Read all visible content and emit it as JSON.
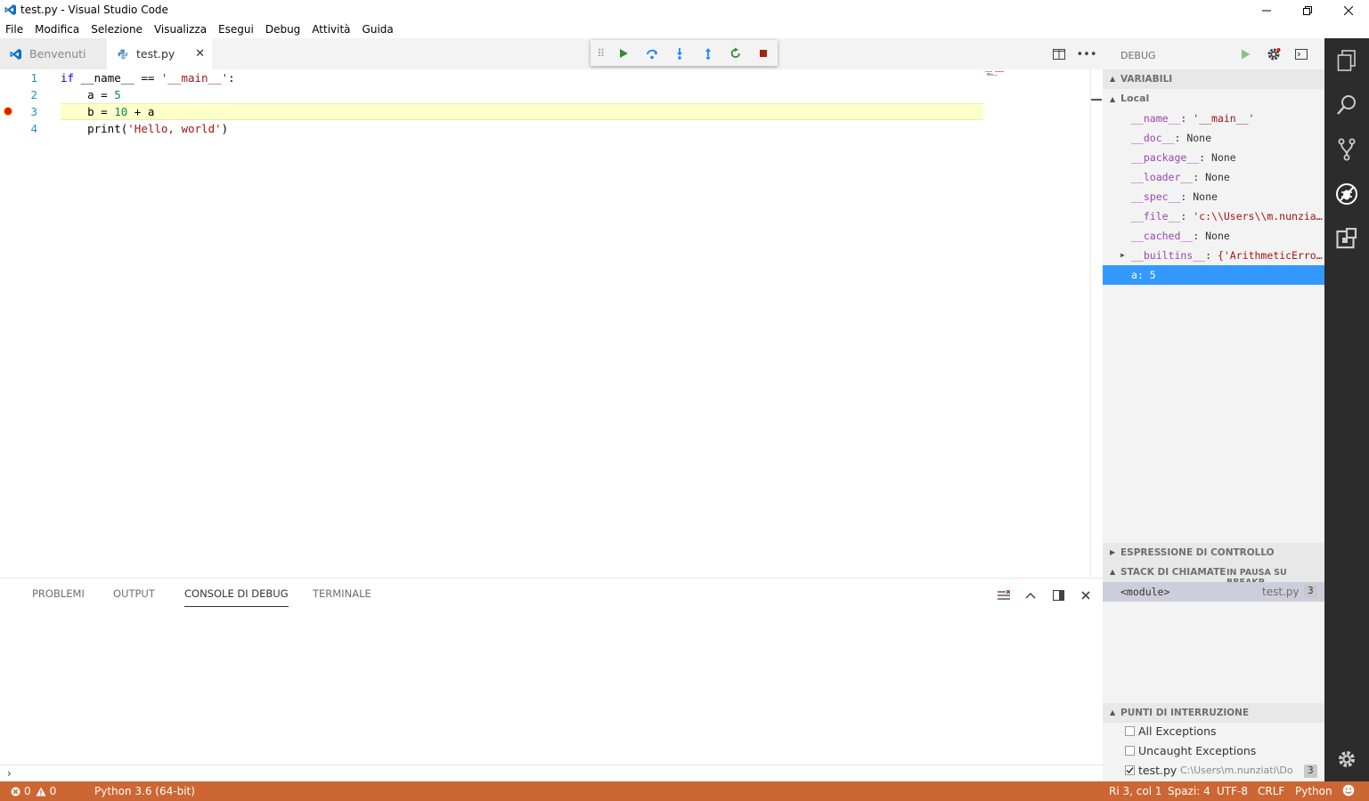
{
  "window": {
    "title": "test.py - Visual Studio Code"
  },
  "menu": [
    "File",
    "Modifica",
    "Selezione",
    "Visualizza",
    "Esegui",
    "Debug",
    "Attività",
    "Guida"
  ],
  "tabs": [
    {
      "label": "Benvenuti",
      "icon": "vscode-logo-icon",
      "active": false
    },
    {
      "label": "test.py",
      "icon": "python-file-icon",
      "active": true
    }
  ],
  "debug_toolbar": [
    "continue-icon",
    "step-over-icon",
    "step-into-icon",
    "step-out-icon",
    "restart-icon",
    "stop-icon"
  ],
  "editor": {
    "line_numbers": [
      "1",
      "2",
      "3",
      "4"
    ],
    "current_line": 3,
    "breakpoint_line": 3,
    "lines": [
      {
        "t1": "if",
        "t2": " __name__ == ",
        "t3": "'__main__'",
        "t4": ":"
      },
      {
        "t1": "    a = ",
        "t2": "5"
      },
      {
        "t1": "    b = ",
        "t2": "10",
        "t3": " + a"
      },
      {
        "t1": "    print(",
        "t2": "'Hello, world'",
        "t3": ")"
      }
    ]
  },
  "panel": {
    "tabs": [
      "PROBLEMI",
      "OUTPUT",
      "CONSOLE DI DEBUG",
      "TERMINALE"
    ],
    "active_tab": "CONSOLE DI DEBUG",
    "prompt": "›"
  },
  "sidebar": {
    "title": "DEBUG",
    "variables": {
      "header": "VARIABILI",
      "scope": "Local",
      "items": [
        {
          "name": "__name__",
          "sep": ": ",
          "value": "'__main__'",
          "kind": "string"
        },
        {
          "name": "__doc__",
          "sep": ": ",
          "value": "None",
          "kind": "none"
        },
        {
          "name": "__package__",
          "sep": ": ",
          "value": "None",
          "kind": "none"
        },
        {
          "name": "__loader__",
          "sep": ": ",
          "value": "None",
          "kind": "none"
        },
        {
          "name": "__spec__",
          "sep": ": ",
          "value": "None",
          "kind": "none"
        },
        {
          "name": "__file__",
          "sep": ": ",
          "value": "'c:\\\\Users\\\\m.nunzia…",
          "kind": "string"
        },
        {
          "name": "__cached__",
          "sep": ": ",
          "value": "None",
          "kind": "none"
        },
        {
          "name": "__builtins__",
          "sep": ": ",
          "value": "{'ArithmeticErro…",
          "kind": "string",
          "expandable": true
        },
        {
          "name": "a",
          "sep": ": ",
          "value": "5",
          "kind": "number",
          "selected": true
        }
      ]
    },
    "watch": {
      "header": "ESPRESSIONE DI CONTROLLO"
    },
    "callstack": {
      "header": "STACK DI CHIAMATE",
      "status": "IN PAUSA SU BREAKP…",
      "frame": {
        "name": "<module>",
        "file": "test.py",
        "line": "3"
      }
    },
    "breakpoints": {
      "header": "PUNTI DI INTERRUZIONE",
      "items": [
        {
          "label": "All Exceptions",
          "checked": false
        },
        {
          "label": "Uncaught Exceptions",
          "checked": false
        },
        {
          "label": "test.py",
          "path": "C:\\Users\\m.nunziati\\Do…",
          "line": "3",
          "checked": true
        }
      ]
    }
  },
  "status": {
    "errors": "0",
    "warnings": "0",
    "interpreter": "Python 3.6 (64-bit)",
    "position": "Ri 3, col 1",
    "spaces": "Spazi: 4",
    "encoding": "UTF-8",
    "eol": "CRLF",
    "language": "Python"
  },
  "colors": {
    "statusbar": "#cc6633",
    "activitybar": "#2c2c2c",
    "selection": "#3399ff",
    "current_line": "#ffffcc"
  }
}
